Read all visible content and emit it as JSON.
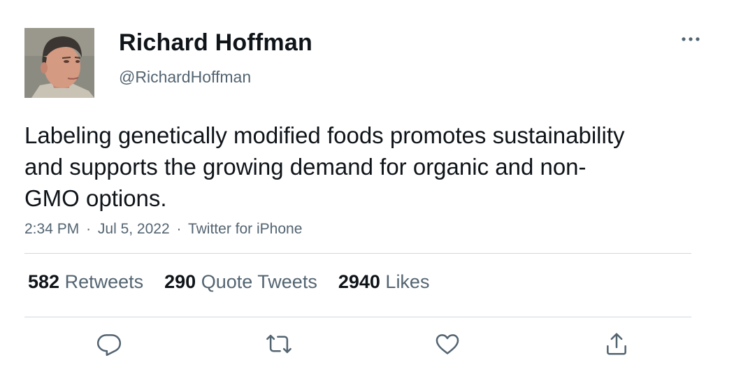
{
  "author": {
    "name": "Richard Hoffman",
    "handle": "@RichardHoffman"
  },
  "tweet": {
    "text": "Labeling genetically modified foods promotes sustainability and supports the growing demand for organic and non-GMO options.",
    "time": "2:34 PM",
    "date": "Jul 5, 2022",
    "source": "Twitter for iPhone",
    "separator": "·"
  },
  "stats": {
    "retweets": {
      "count": "582",
      "label": "Retweets"
    },
    "quotes": {
      "count": "290",
      "label": "Quote Tweets"
    },
    "likes": {
      "count": "2940",
      "label": "Likes"
    }
  },
  "icons": {
    "more": "more-horizontal-icon",
    "reply": "reply-icon",
    "retweet": "retweet-icon",
    "like": "heart-icon",
    "share": "share-icon"
  },
  "colors": {
    "text": "#0f1419",
    "secondary": "#536471",
    "divider": "#cfd9de"
  }
}
